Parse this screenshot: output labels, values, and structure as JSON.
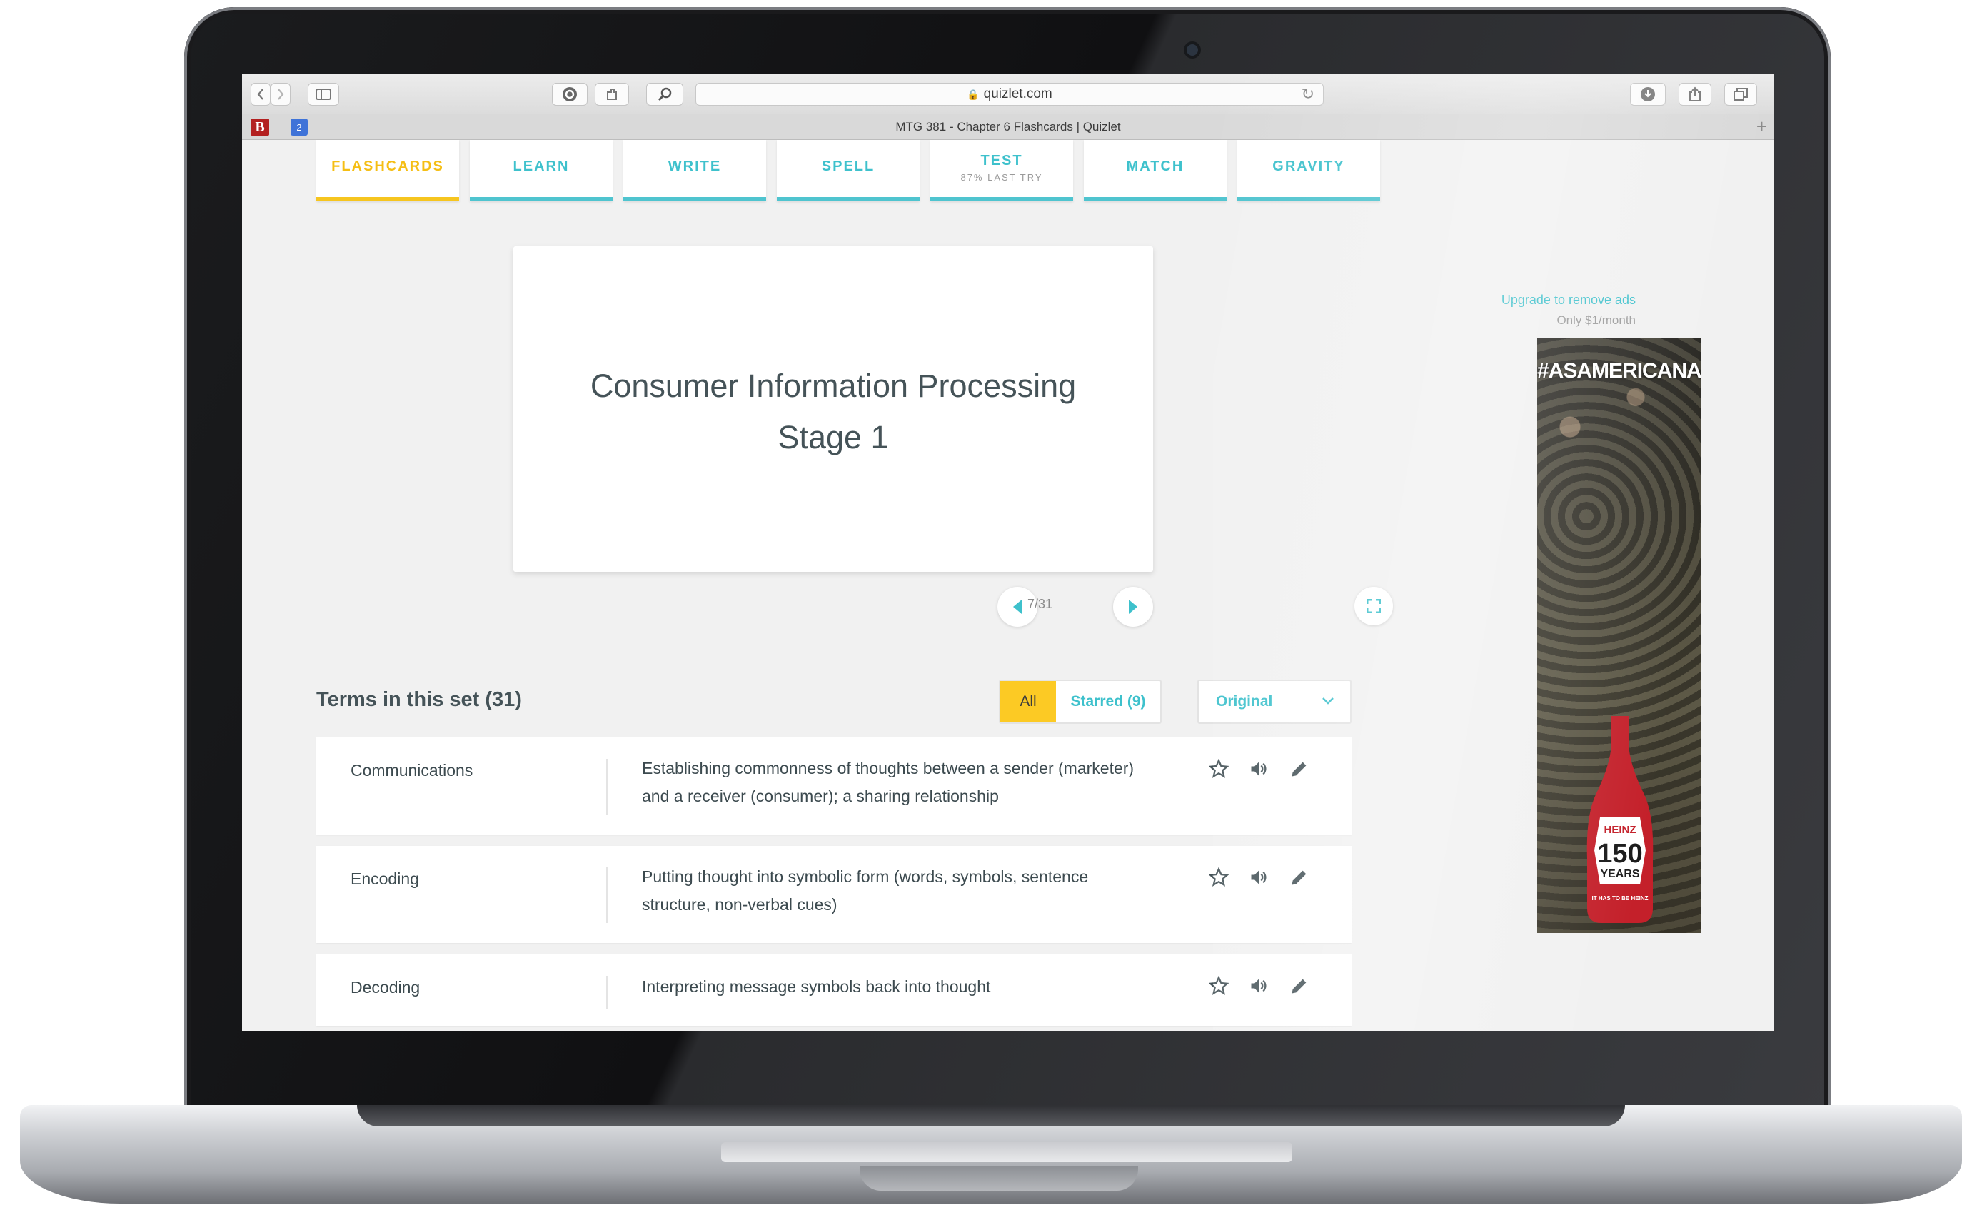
{
  "browser": {
    "url": "quizlet.com",
    "tab_title": "MTG 381 - Chapter 6 Flashcards | Quizlet",
    "calendar_badge": "2"
  },
  "modes": [
    {
      "label": "FLASHCARDS",
      "active": true
    },
    {
      "label": "LEARN"
    },
    {
      "label": "WRITE"
    },
    {
      "label": "SPELL"
    },
    {
      "label": "TEST",
      "sub": "87% LAST TRY"
    },
    {
      "label": "MATCH"
    },
    {
      "label": "GRAVITY"
    }
  ],
  "card": {
    "line1": "Consumer Information Processing",
    "line2": "Stage 1",
    "counter": "7/31"
  },
  "terms": {
    "title": "Terms in this set (31)",
    "filter_all": "All",
    "filter_starred": "Starred (9)",
    "sort": "Original",
    "rows": [
      {
        "term": "Communications",
        "def_line1": "Establishing commonness of thoughts between a sender (marketer)",
        "def_line2": "and a receiver (consumer); a sharing relationship"
      },
      {
        "term": "Encoding",
        "def_line1": "Putting thought into symbolic form (words, symbols, sentence",
        "def_line2": "structure, non-verbal cues)"
      },
      {
        "term": "Decoding",
        "def_line1": "Interpreting message symbols back into thought",
        "def_line2": ""
      }
    ]
  },
  "ad": {
    "upgrade": "Upgrade to remove ads",
    "price": "Only $1/month",
    "hashtag": "#ASAMERICANAS",
    "brand": "HEINZ",
    "years": "150",
    "years_label": "YEARS",
    "slogan": "IT HAS TO BE HEINZ"
  },
  "colors": {
    "accent": "#3ec1cc",
    "active": "#f5be14",
    "text": "#455358"
  }
}
